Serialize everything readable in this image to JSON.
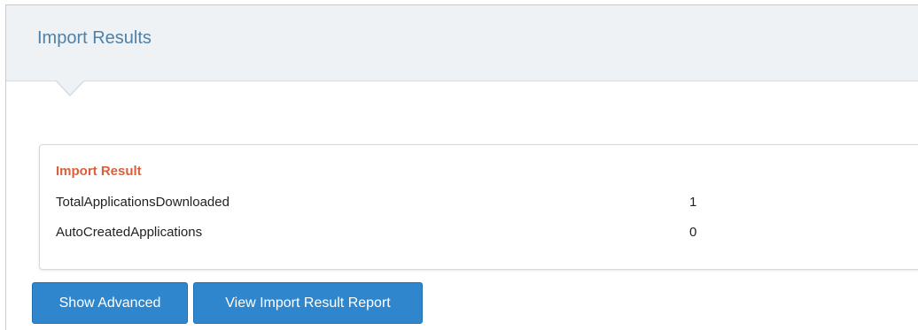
{
  "header": {
    "title": "Import Results"
  },
  "card": {
    "title": "Import Result",
    "rows": [
      {
        "label": "TotalApplicationsDownloaded",
        "value": "1"
      },
      {
        "label": "AutoCreatedApplications",
        "value": "0"
      }
    ]
  },
  "actions": {
    "show_advanced_label": "Show Advanced",
    "view_report_label": "View Import Result Report"
  },
  "colors": {
    "header_title": "#4f81a8",
    "card_title": "#d9603b",
    "button_bg": "#2f86cc",
    "header_bg": "#eef2f5"
  }
}
